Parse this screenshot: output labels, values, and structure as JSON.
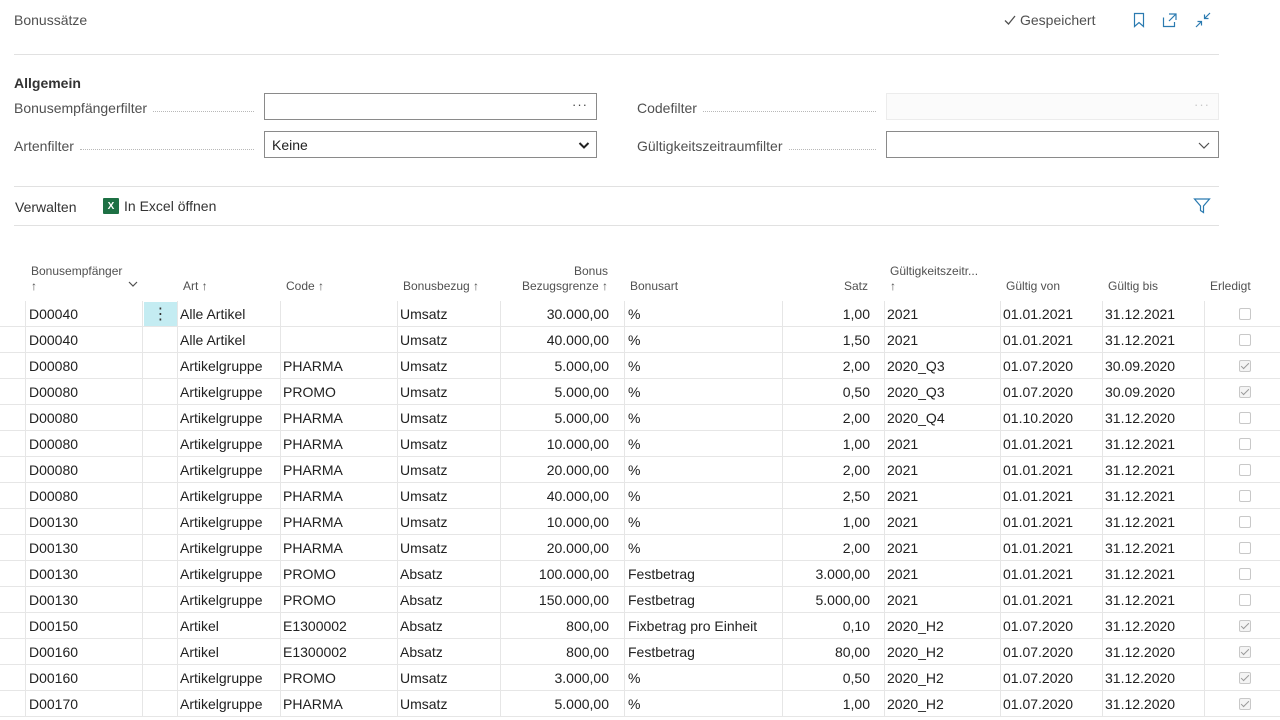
{
  "page": {
    "title": "Bonussätze",
    "saved_label": "Gespeichert"
  },
  "general": {
    "heading": "Allgemein",
    "recipient_filter_label": "Bonusempfängerfilter",
    "recipient_filter_value": "",
    "recipient_filter_btn": "···",
    "code_filter_label": "Codefilter",
    "code_filter_value": "",
    "code_filter_btn": "···",
    "type_filter_label": "Artenfilter",
    "type_filter_value": "Keine",
    "period_filter_label": "Gültigkeitszeitraumfilter",
    "period_filter_value": ""
  },
  "actions": {
    "manage": "Verwalten",
    "excel": "In Excel öffnen",
    "excel_icon_text": "X"
  },
  "columns": {
    "recipient": "Bonusempfänger",
    "recipient_sort": "↑",
    "type": "Art ↑",
    "code": "Code ↑",
    "reference": "Bonusbezug ↑",
    "limit_line1": "Bonus",
    "limit_line2": "Bezugsgrenze ↑",
    "bonus_type": "Bonusart",
    "rate": "Satz",
    "period": "Gültigkeitszeitr...",
    "period_sort": "↑",
    "valid_from": "Gültig von",
    "valid_to": "Gültig bis",
    "done": "Erledigt"
  },
  "row_menu_glyph": "⋮",
  "rows": [
    {
      "recipient": "D00040",
      "type": "Alle Artikel",
      "code": "",
      "reference": "Umsatz",
      "limit": "30.000,00",
      "bonus_type": "%",
      "rate": "1,00",
      "period": "2021",
      "from": "01.01.2021",
      "to": "31.12.2021",
      "done": false
    },
    {
      "recipient": "D00040",
      "type": "Alle Artikel",
      "code": "",
      "reference": "Umsatz",
      "limit": "40.000,00",
      "bonus_type": "%",
      "rate": "1,50",
      "period": "2021",
      "from": "01.01.2021",
      "to": "31.12.2021",
      "done": false
    },
    {
      "recipient": "D00080",
      "type": "Artikelgruppe",
      "code": "PHARMA",
      "reference": "Umsatz",
      "limit": "5.000,00",
      "bonus_type": "%",
      "rate": "2,00",
      "period": "2020_Q3",
      "from": "01.07.2020",
      "to": "30.09.2020",
      "done": true
    },
    {
      "recipient": "D00080",
      "type": "Artikelgruppe",
      "code": "PROMO",
      "reference": "Umsatz",
      "limit": "5.000,00",
      "bonus_type": "%",
      "rate": "0,50",
      "period": "2020_Q3",
      "from": "01.07.2020",
      "to": "30.09.2020",
      "done": true
    },
    {
      "recipient": "D00080",
      "type": "Artikelgruppe",
      "code": "PHARMA",
      "reference": "Umsatz",
      "limit": "5.000,00",
      "bonus_type": "%",
      "rate": "2,00",
      "period": "2020_Q4",
      "from": "01.10.2020",
      "to": "31.12.2020",
      "done": false
    },
    {
      "recipient": "D00080",
      "type": "Artikelgruppe",
      "code": "PHARMA",
      "reference": "Umsatz",
      "limit": "10.000,00",
      "bonus_type": "%",
      "rate": "1,00",
      "period": "2021",
      "from": "01.01.2021",
      "to": "31.12.2021",
      "done": false
    },
    {
      "recipient": "D00080",
      "type": "Artikelgruppe",
      "code": "PHARMA",
      "reference": "Umsatz",
      "limit": "20.000,00",
      "bonus_type": "%",
      "rate": "2,00",
      "period": "2021",
      "from": "01.01.2021",
      "to": "31.12.2021",
      "done": false
    },
    {
      "recipient": "D00080",
      "type": "Artikelgruppe",
      "code": "PHARMA",
      "reference": "Umsatz",
      "limit": "40.000,00",
      "bonus_type": "%",
      "rate": "2,50",
      "period": "2021",
      "from": "01.01.2021",
      "to": "31.12.2021",
      "done": false
    },
    {
      "recipient": "D00130",
      "type": "Artikelgruppe",
      "code": "PHARMA",
      "reference": "Umsatz",
      "limit": "10.000,00",
      "bonus_type": "%",
      "rate": "1,00",
      "period": "2021",
      "from": "01.01.2021",
      "to": "31.12.2021",
      "done": false
    },
    {
      "recipient": "D00130",
      "type": "Artikelgruppe",
      "code": "PHARMA",
      "reference": "Umsatz",
      "limit": "20.000,00",
      "bonus_type": "%",
      "rate": "2,00",
      "period": "2021",
      "from": "01.01.2021",
      "to": "31.12.2021",
      "done": false
    },
    {
      "recipient": "D00130",
      "type": "Artikelgruppe",
      "code": "PROMO",
      "reference": "Absatz",
      "limit": "100.000,00",
      "bonus_type": "Festbetrag",
      "rate": "3.000,00",
      "period": "2021",
      "from": "01.01.2021",
      "to": "31.12.2021",
      "done": false
    },
    {
      "recipient": "D00130",
      "type": "Artikelgruppe",
      "code": "PROMO",
      "reference": "Absatz",
      "limit": "150.000,00",
      "bonus_type": "Festbetrag",
      "rate": "5.000,00",
      "period": "2021",
      "from": "01.01.2021",
      "to": "31.12.2021",
      "done": false
    },
    {
      "recipient": "D00150",
      "type": "Artikel",
      "code": "E1300002",
      "reference": "Absatz",
      "limit": "800,00",
      "bonus_type": "Fixbetrag pro Einheit",
      "rate": "0,10",
      "period": "2020_H2",
      "from": "01.07.2020",
      "to": "31.12.2020",
      "done": true
    },
    {
      "recipient": "D00160",
      "type": "Artikel",
      "code": "E1300002",
      "reference": "Absatz",
      "limit": "800,00",
      "bonus_type": "Festbetrag",
      "rate": "80,00",
      "period": "2020_H2",
      "from": "01.07.2020",
      "to": "31.12.2020",
      "done": true
    },
    {
      "recipient": "D00160",
      "type": "Artikelgruppe",
      "code": "PROMO",
      "reference": "Umsatz",
      "limit": "3.000,00",
      "bonus_type": "%",
      "rate": "0,50",
      "period": "2020_H2",
      "from": "01.07.2020",
      "to": "31.12.2020",
      "done": true
    },
    {
      "recipient": "D00170",
      "type": "Artikelgruppe",
      "code": "PHARMA",
      "reference": "Umsatz",
      "limit": "5.000,00",
      "bonus_type": "%",
      "rate": "1,00",
      "period": "2020_H2",
      "from": "01.07.2020",
      "to": "31.12.2020",
      "done": true
    }
  ]
}
